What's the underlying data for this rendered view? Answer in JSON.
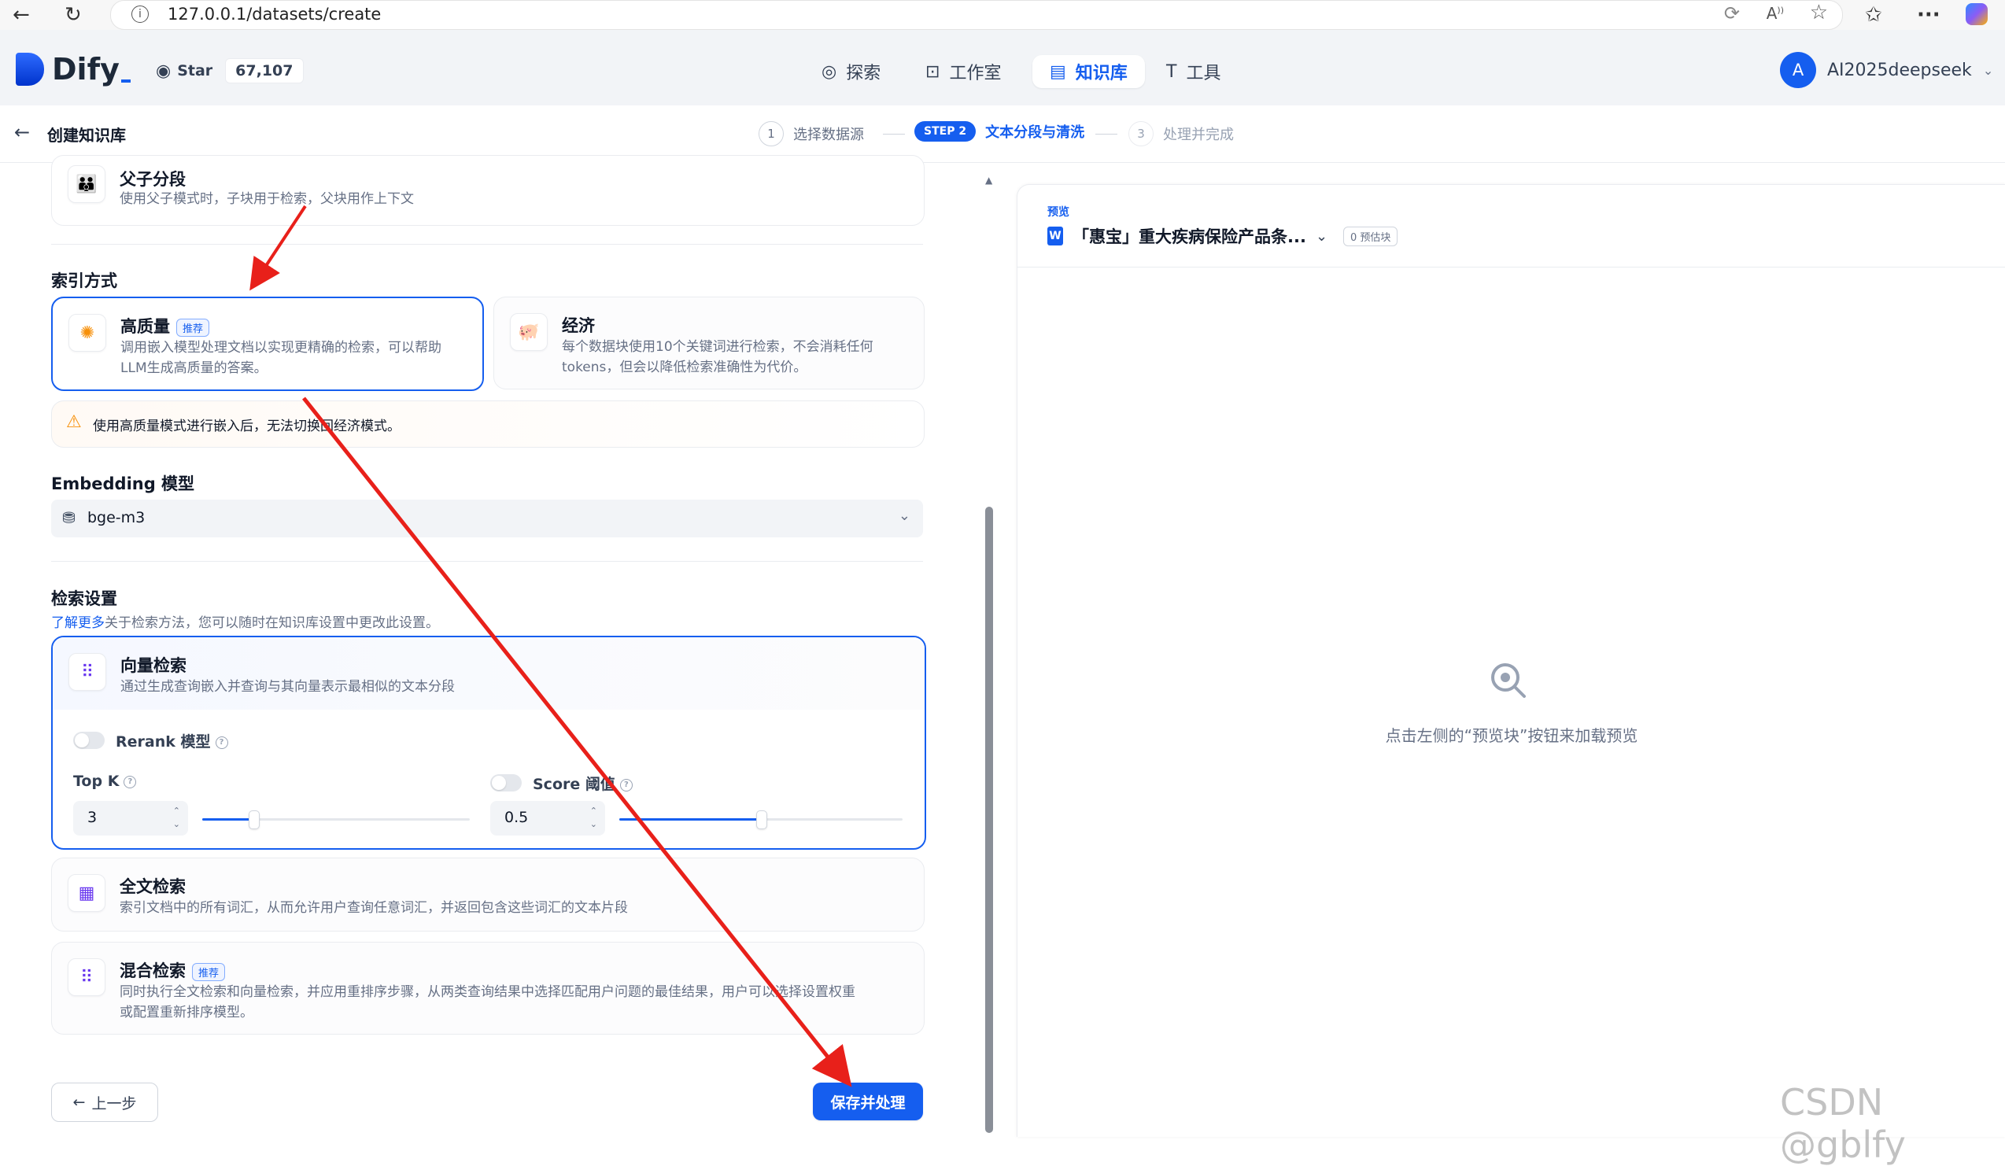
{
  "browser": {
    "url": "127.0.0.1/datasets/create"
  },
  "header": {
    "brand": "Dify",
    "star_label": "Star",
    "star_count": "67,107",
    "nav": [
      {
        "label": "探索"
      },
      {
        "label": "工作室"
      },
      {
        "label": "知识库"
      },
      {
        "label": "工具"
      }
    ],
    "user_initial": "A",
    "user_name": "AI2025deepseek"
  },
  "subheader": {
    "back_title": "创建知识库",
    "steps": [
      {
        "num": "1",
        "label": "选择数据源"
      },
      {
        "num": "STEP 2",
        "label": "文本分段与清洗"
      },
      {
        "num": "3",
        "label": "处理并完成"
      }
    ]
  },
  "segment": {
    "parent_child_title": "父子分段",
    "parent_child_desc": "使用父子模式时，子块用于检索，父块用作上下文"
  },
  "index": {
    "section_title": "索引方式",
    "high_quality_title": "高质量",
    "recommend_badge": "推荐",
    "high_quality_desc_1": "调用嵌入模型处理文档以实现更精确的检索，可以帮助",
    "high_quality_desc_2": "LLM生成高质量的答案。",
    "economy_title": "经济",
    "economy_desc_1": "每个数据块使用10个关键词进行检索，不会消耗任何",
    "economy_desc_2": "tokens，但会以降低检索准确性为代价。",
    "warning": "使用高质量模式进行嵌入后，无法切换回经济模式。"
  },
  "embedding": {
    "title": "Embedding 模型",
    "model": "bge-m3"
  },
  "retrieval": {
    "section_title": "检索设置",
    "learn_more": "了解更多",
    "hint": "关于检索方法，您可以随时在知识库设置中更改此设置。",
    "vector_title": "向量检索",
    "vector_desc": "通过生成查询嵌入并查询与其向量表示最相似的文本分段",
    "rerank_label": "Rerank 模型",
    "topk_label": "Top K",
    "topk_value": "3",
    "topk_fraction": 0.19,
    "score_label": "Score 阈值",
    "score_value": "0.5",
    "score_fraction": 0.5,
    "fulltext_title": "全文检索",
    "fulltext_desc": "索引文档中的所有词汇，从而允许用户查询任意词汇，并返回包含这些词汇的文本片段",
    "hybrid_title": "混合检索",
    "hybrid_desc_1": "同时执行全文检索和向量检索，并应用重排序步骤，从两类查询结果中选择匹配用户问题的最佳结果，用户可以选择设置权重",
    "hybrid_desc_2": "或配置重新排序模型。"
  },
  "footer": {
    "prev_label": "上一步",
    "save_label": "保存并处理"
  },
  "preview": {
    "label": "预览",
    "doc_title": "「惠宝」重大疾病保险产品条...",
    "chunk_badge": "0 预估块",
    "empty_hint": "点击左侧的“预览块”按钮来加载预览"
  },
  "watermark": "CSDN @gblfy",
  "colors": {
    "accent": "#155eef",
    "annotation_arrow": "#e8201a",
    "warning": "#f79009"
  }
}
